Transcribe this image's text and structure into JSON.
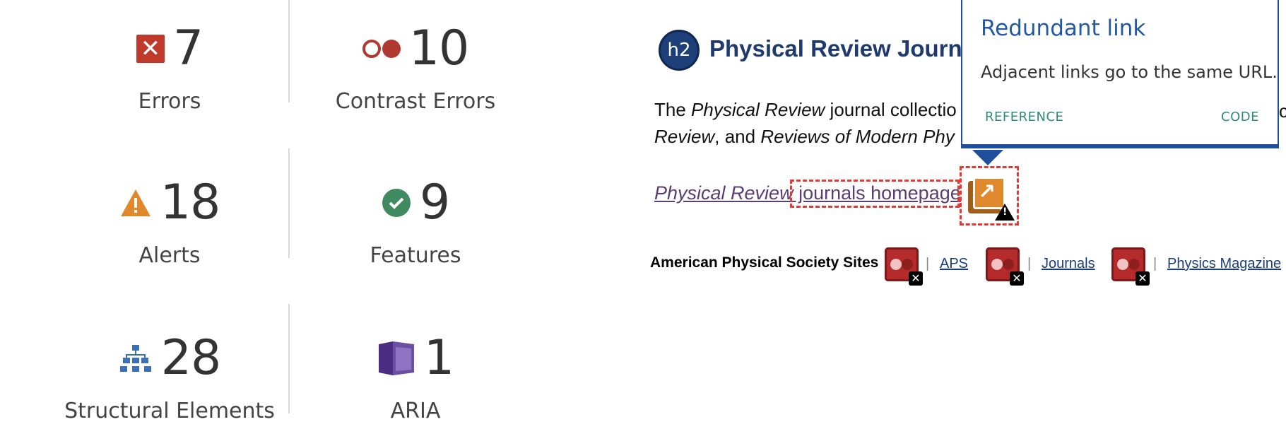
{
  "summary": {
    "errors": {
      "count": "7",
      "label": "Errors"
    },
    "contrast_errors": {
      "count": "10",
      "label": "Contrast Errors"
    },
    "alerts": {
      "count": "18",
      "label": "Alerts"
    },
    "features": {
      "count": "9",
      "label": "Features"
    },
    "structural": {
      "count": "28",
      "label": "Structural Elements"
    },
    "aria": {
      "count": "1",
      "label": "ARIA"
    }
  },
  "preview": {
    "h2_badge": "h2",
    "journal_title": "Physical Review Journa",
    "para_line1_a": "The ",
    "para_line1_i": "Physical Review",
    "para_line1_b": " journal collectio",
    "para_line2_i1": "Review",
    "para_line2_a": ", and ",
    "para_line2_i2": "Reviews of Modern Phy",
    "homepage_italic": "Physical Review",
    "homepage_link": " journals homepage",
    "aps_label": "American Physical Society Sites",
    "aps_links": [
      "APS",
      "Journals",
      "Physics Magazine"
    ],
    "separator": "|",
    "behind_c": "c"
  },
  "tooltip": {
    "title": "Redundant link",
    "description": "Adjacent links go to the same URL.",
    "reference": "REFERENCE",
    "code": "CODE"
  },
  "colors": {
    "error": "#c0392b",
    "alert": "#e0882c",
    "feature": "#3f8a5e",
    "structural": "#3d6fb5",
    "aria": "#4b2e83",
    "tooltip_border": "#1f4e9c",
    "tooltip_action": "#2e8b7a"
  },
  "icons": {
    "errors": "error-x-icon",
    "contrast": "contrast-circles-icon",
    "alerts": "warning-triangle-icon",
    "features": "checkmark-circle-icon",
    "structural": "hierarchy-icon",
    "aria": "aria-cube-icon"
  }
}
